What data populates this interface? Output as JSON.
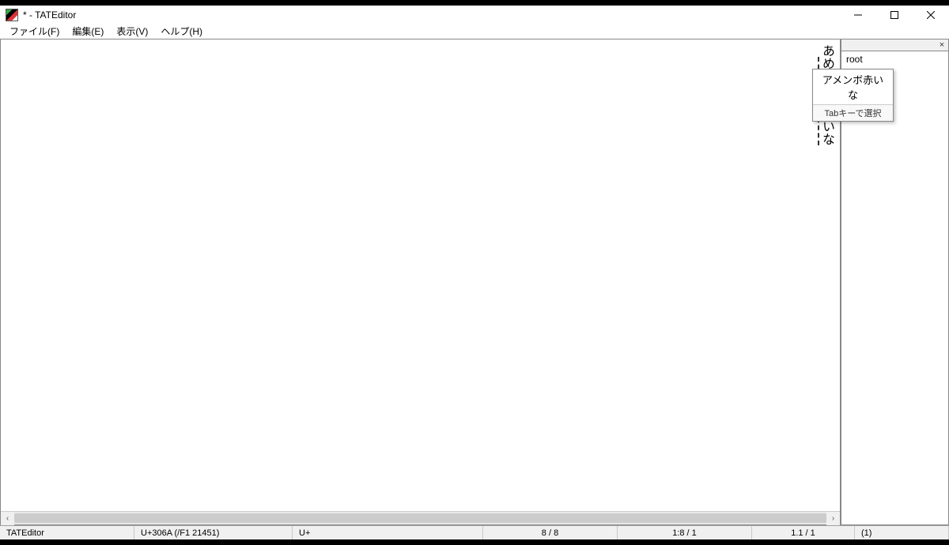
{
  "title": "* - TATEditor",
  "menu": {
    "file": "ファイル(F)",
    "edit": "編集(E)",
    "view": "表示(V)",
    "help": "ヘルプ(H)"
  },
  "editor": {
    "line1_pre": "あ",
    "line1_post": "めんぼあかいな"
  },
  "ime": {
    "candidate": "アメンボ赤いな",
    "hint": "Tabキーで選択"
  },
  "side": {
    "root": "root"
  },
  "status": {
    "app": "TATEditor",
    "codepoint": "U+306A (/F1 21451)",
    "uplus": "U+",
    "ratio": "8 / 8",
    "pos": "1:8 / 1",
    "zoom": "1.1 / 1",
    "paren": "(1)"
  },
  "icons": {
    "hscroll_left": "‹",
    "hscroll_right": "›",
    "side_close": "×"
  }
}
